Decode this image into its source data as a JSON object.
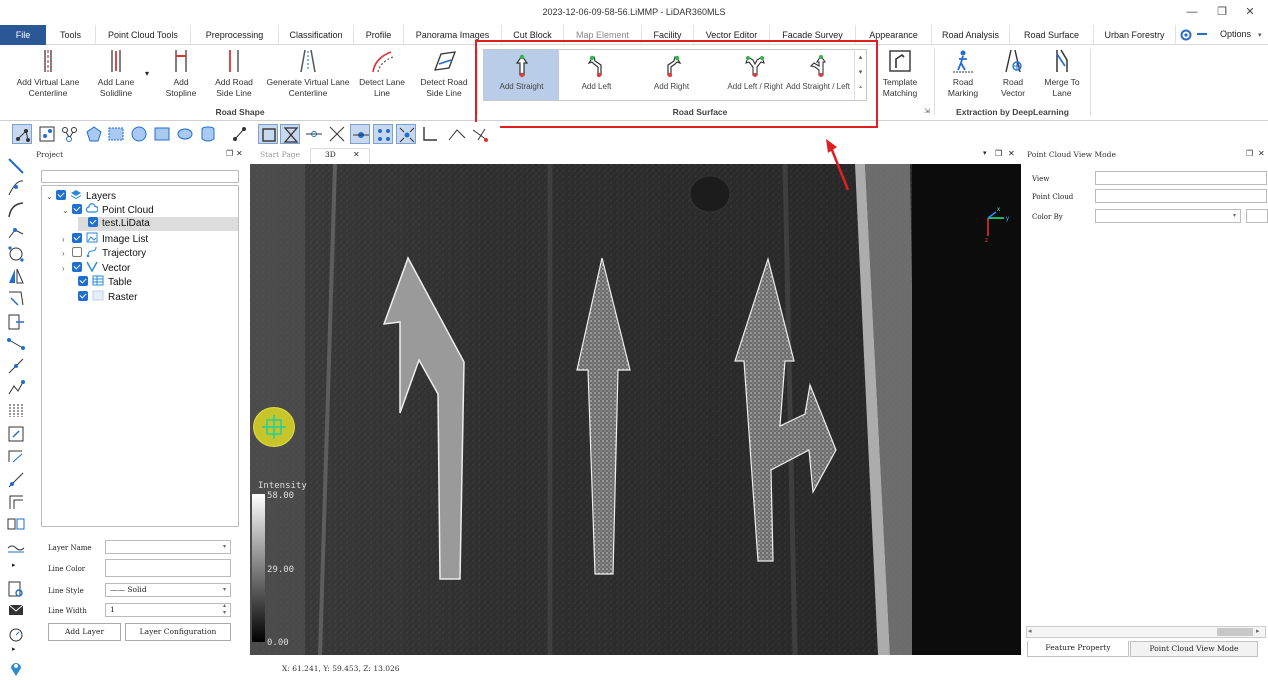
{
  "window": {
    "title": "2023-12-06-09-58-56.LiMMP - LiDAR360MLS",
    "minimize": "—",
    "restore": "❐",
    "close": "✕"
  },
  "tabs": [
    "File",
    "Tools",
    "Point Cloud Tools",
    "Preprocessing",
    "Classification",
    "Profile",
    "Panorama Images",
    "Cut Block",
    "Map Element",
    "Facility",
    "Vector Editor",
    "Facade Survey",
    "Appearance",
    "Road Analysis",
    "Road Surface",
    "Urban Forestry"
  ],
  "options_label": "Options",
  "ribbon": {
    "road_shape": {
      "label": "Road Shape",
      "buttons": [
        {
          "l1": "Add Virtual Lane",
          "l2": "Centerline"
        },
        {
          "l1": "Add Lane",
          "l2": "Solidline"
        },
        {
          "l1": "Add",
          "l2": "Stopline"
        },
        {
          "l1": "Add Road",
          "l2": "Side Line"
        },
        {
          "l1": "Generate Virtual Lane",
          "l2": "Centerline"
        },
        {
          "l1": "Detect Lane",
          "l2": "Line"
        },
        {
          "l1": "Detect Road",
          "l2": "Side Line"
        }
      ]
    },
    "road_surface": {
      "label": "Road Surface",
      "items": [
        "Add Straight",
        "Add Left",
        "Add Right",
        "Add Left / Right",
        "Add Straight / Left"
      ]
    },
    "template": {
      "l1": "Template",
      "l2": "Matching"
    },
    "deep_learning": {
      "label": "Extraction by DeepLearning",
      "buttons": [
        {
          "l1": "Road",
          "l2": "Marking"
        },
        {
          "l1": "Road",
          "l2": "Vector"
        },
        {
          "l1": "Merge To",
          "l2": "Lane"
        }
      ]
    }
  },
  "project": {
    "title": "Project",
    "tree": [
      {
        "label": "Layers",
        "checked": true
      },
      {
        "label": "Point Cloud",
        "checked": true
      },
      {
        "label": "test.LiData",
        "checked": true
      },
      {
        "label": "Image List",
        "checked": true
      },
      {
        "label": "Trajectory",
        "checked": false
      },
      {
        "label": "Vector",
        "checked": true
      },
      {
        "label": "Table",
        "checked": true
      },
      {
        "label": "Raster",
        "checked": true
      }
    ],
    "props": {
      "layer_name": "Layer Name",
      "line_color": "Line Color",
      "line_style": "Line Style",
      "line_style_value": "—— Solid",
      "line_width": "Line Width",
      "line_width_value": "1",
      "add_layer": "Add Layer",
      "layer_config": "Layer Configuration"
    }
  },
  "view": {
    "tabs": [
      "Start Page",
      "3D"
    ],
    "intensity": {
      "title": "Intensity",
      "max": "58.00",
      "mid": "29.00",
      "min": "0.00"
    },
    "axis": {
      "x": "x",
      "y": "y",
      "z": "z"
    }
  },
  "rightpanel": {
    "title": "Point Cloud View Mode",
    "view_label": "View",
    "point_cloud_label": "Point Cloud",
    "color_by_label": "Color By",
    "bottom_tabs": [
      "Feature Property",
      "Point Cloud View Mode"
    ]
  },
  "status": {
    "coords": "X: 61.241, Y: 59.453, Z: 13.026"
  },
  "colors": {
    "file_tab": "#2b5797",
    "accent_blue": "#1e6fd0",
    "highlight": "#e02020",
    "selected": "#b9cde8"
  }
}
